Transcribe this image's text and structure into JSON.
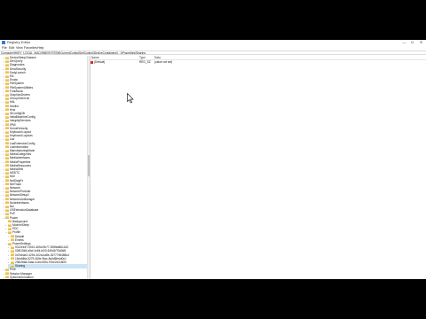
{
  "window": {
    "title": "Registry Editor",
    "controls": {
      "minimize": "—",
      "maximize": "☐",
      "close": "✕"
    }
  },
  "menu": [
    "File",
    "Edit",
    "View",
    "Favorites",
    "Help"
  ],
  "address": "Computer\\HKEY_LOCAL_MACHINE\\SYSTEM\\CurrentControlSet\\Control\\DeviceContainers\\{...}\\Properties\\Sharing",
  "tree": [
    {
      "label": "DeviceSetupClasses",
      "depth": 1,
      "twist": "›"
    },
    {
      "label": "DevQuery",
      "depth": 1,
      "twist": "›"
    },
    {
      "label": "Diagnostics",
      "depth": 1,
      "twist": "›"
    },
    {
      "label": "DmaSecurity",
      "depth": 1,
      "twist": "›"
    },
    {
      "label": "EarlyLaunch",
      "depth": 1,
      "twist": "›"
    },
    {
      "label": "Els",
      "depth": 1,
      "twist": "›"
    },
    {
      "label": "Errata",
      "depth": 1,
      "twist": "›"
    },
    {
      "label": "FileSystem",
      "depth": 1,
      "twist": "›"
    },
    {
      "label": "FileSystemUtilities",
      "depth": 1,
      "twist": "›"
    },
    {
      "label": "FontAssoc",
      "depth": 1,
      "twist": "›"
    },
    {
      "label": "GraphicsDrivers",
      "depth": 1,
      "twist": "›"
    },
    {
      "label": "GroupOrderList",
      "depth": 1,
      "twist": ""
    },
    {
      "label": "HAL",
      "depth": 1,
      "twist": "›"
    },
    {
      "label": "hivelist",
      "depth": 1,
      "twist": ""
    },
    {
      "label": "Hvsi",
      "depth": 1,
      "twist": "›"
    },
    {
      "label": "IDConfigDB",
      "depth": 1,
      "twist": "›"
    },
    {
      "label": "InitialMachineConfig",
      "depth": 1,
      "twist": ""
    },
    {
      "label": "IntegrityServices",
      "depth": 1,
      "twist": "›"
    },
    {
      "label": "IPMI",
      "depth": 1,
      "twist": "›"
    },
    {
      "label": "KernelVelocity",
      "depth": 1,
      "twist": "›"
    },
    {
      "label": "Keyboard Layout",
      "depth": 1,
      "twist": "›"
    },
    {
      "label": "Keyboard Layouts",
      "depth": 1,
      "twist": "›"
    },
    {
      "label": "Lsa",
      "depth": 1,
      "twist": "›"
    },
    {
      "label": "LsaExtensionConfig",
      "depth": 1,
      "twist": "›"
    },
    {
      "label": "LsaInformation",
      "depth": 1,
      "twist": ""
    },
    {
      "label": "ManufacturingMode",
      "depth": 1,
      "twist": "›"
    },
    {
      "label": "MediaCategories",
      "depth": 1,
      "twist": "›"
    },
    {
      "label": "MediaInterfaces",
      "depth": 1,
      "twist": "›"
    },
    {
      "label": "MediaProperties",
      "depth": 1,
      "twist": "›"
    },
    {
      "label": "MediaResources",
      "depth": 1,
      "twist": "›"
    },
    {
      "label": "MediaSets",
      "depth": 1,
      "twist": "›"
    },
    {
      "label": "MSDTC",
      "depth": 1,
      "twist": "›"
    },
    {
      "label": "MUI",
      "depth": 1,
      "twist": "›"
    },
    {
      "label": "NetDiagFx",
      "depth": 1,
      "twist": "›"
    },
    {
      "label": "NetTrace",
      "depth": 1,
      "twist": "›"
    },
    {
      "label": "Network",
      "depth": 1,
      "twist": "›"
    },
    {
      "label": "NetworkProvider",
      "depth": 1,
      "twist": "›"
    },
    {
      "label": "NetworkSetup2",
      "depth": 1,
      "twist": "›"
    },
    {
      "label": "NetworkUxManager",
      "depth": 1,
      "twist": "›"
    },
    {
      "label": "NodeInterfaces",
      "depth": 1,
      "twist": "›"
    },
    {
      "label": "Nsi",
      "depth": 1,
      "twist": "›"
    },
    {
      "label": "OSExtensionDatabase",
      "depth": 1,
      "twist": "›"
    },
    {
      "label": "PnP",
      "depth": 1,
      "twist": "›"
    },
    {
      "label": "Power",
      "depth": 1,
      "twist": "⌄"
    },
    {
      "label": "Background",
      "depth": 2,
      "twist": ""
    },
    {
      "label": "ModernSleep",
      "depth": 2,
      "twist": "›"
    },
    {
      "label": "PDC",
      "depth": 2,
      "twist": "›"
    },
    {
      "label": "Profile",
      "depth": 2,
      "twist": "⌄"
    },
    {
      "label": "Default",
      "depth": 3,
      "twist": "›"
    },
    {
      "label": "Events",
      "depth": 3,
      "twist": "›"
    },
    {
      "label": "PowerSettings",
      "depth": 2,
      "twist": "⌄"
    },
    {
      "label": "0012ee47-9041-4b5d-9b77-535fba8b1442",
      "depth": 3,
      "twist": "›"
    },
    {
      "label": "02f815b5-a5cf-4c84-bf20-649d1f75d3d8",
      "depth": 3,
      "twist": "›"
    },
    {
      "label": "0d7dbae2-4294-402a-ba8e-26777e8488cd",
      "depth": 3,
      "twist": "›"
    },
    {
      "label": "19cbb8fa-5279-450e-9fac-8a3d5fedd0c1",
      "depth": 3,
      "twist": "›"
    },
    {
      "label": "238c9fa8-0aad-41ed-83f4-97be242c8f20",
      "depth": 3,
      "twist": "›"
    },
    {
      "label": "Sharing",
      "depth": 3,
      "twist": "",
      "selected": true
    },
    {
      "label": "Print",
      "depth": 1,
      "twist": "›"
    },
    {
      "label": "Session Manager",
      "depth": 1,
      "twist": "›"
    },
    {
      "label": "SystemInformation",
      "depth": 1,
      "twist": "›"
    }
  ],
  "list": {
    "headers": {
      "name": "Name",
      "type": "Type",
      "data": "Data"
    },
    "rows": [
      {
        "name": "(Default)",
        "type": "REG_SZ",
        "data": "(value not set)"
      }
    ]
  }
}
